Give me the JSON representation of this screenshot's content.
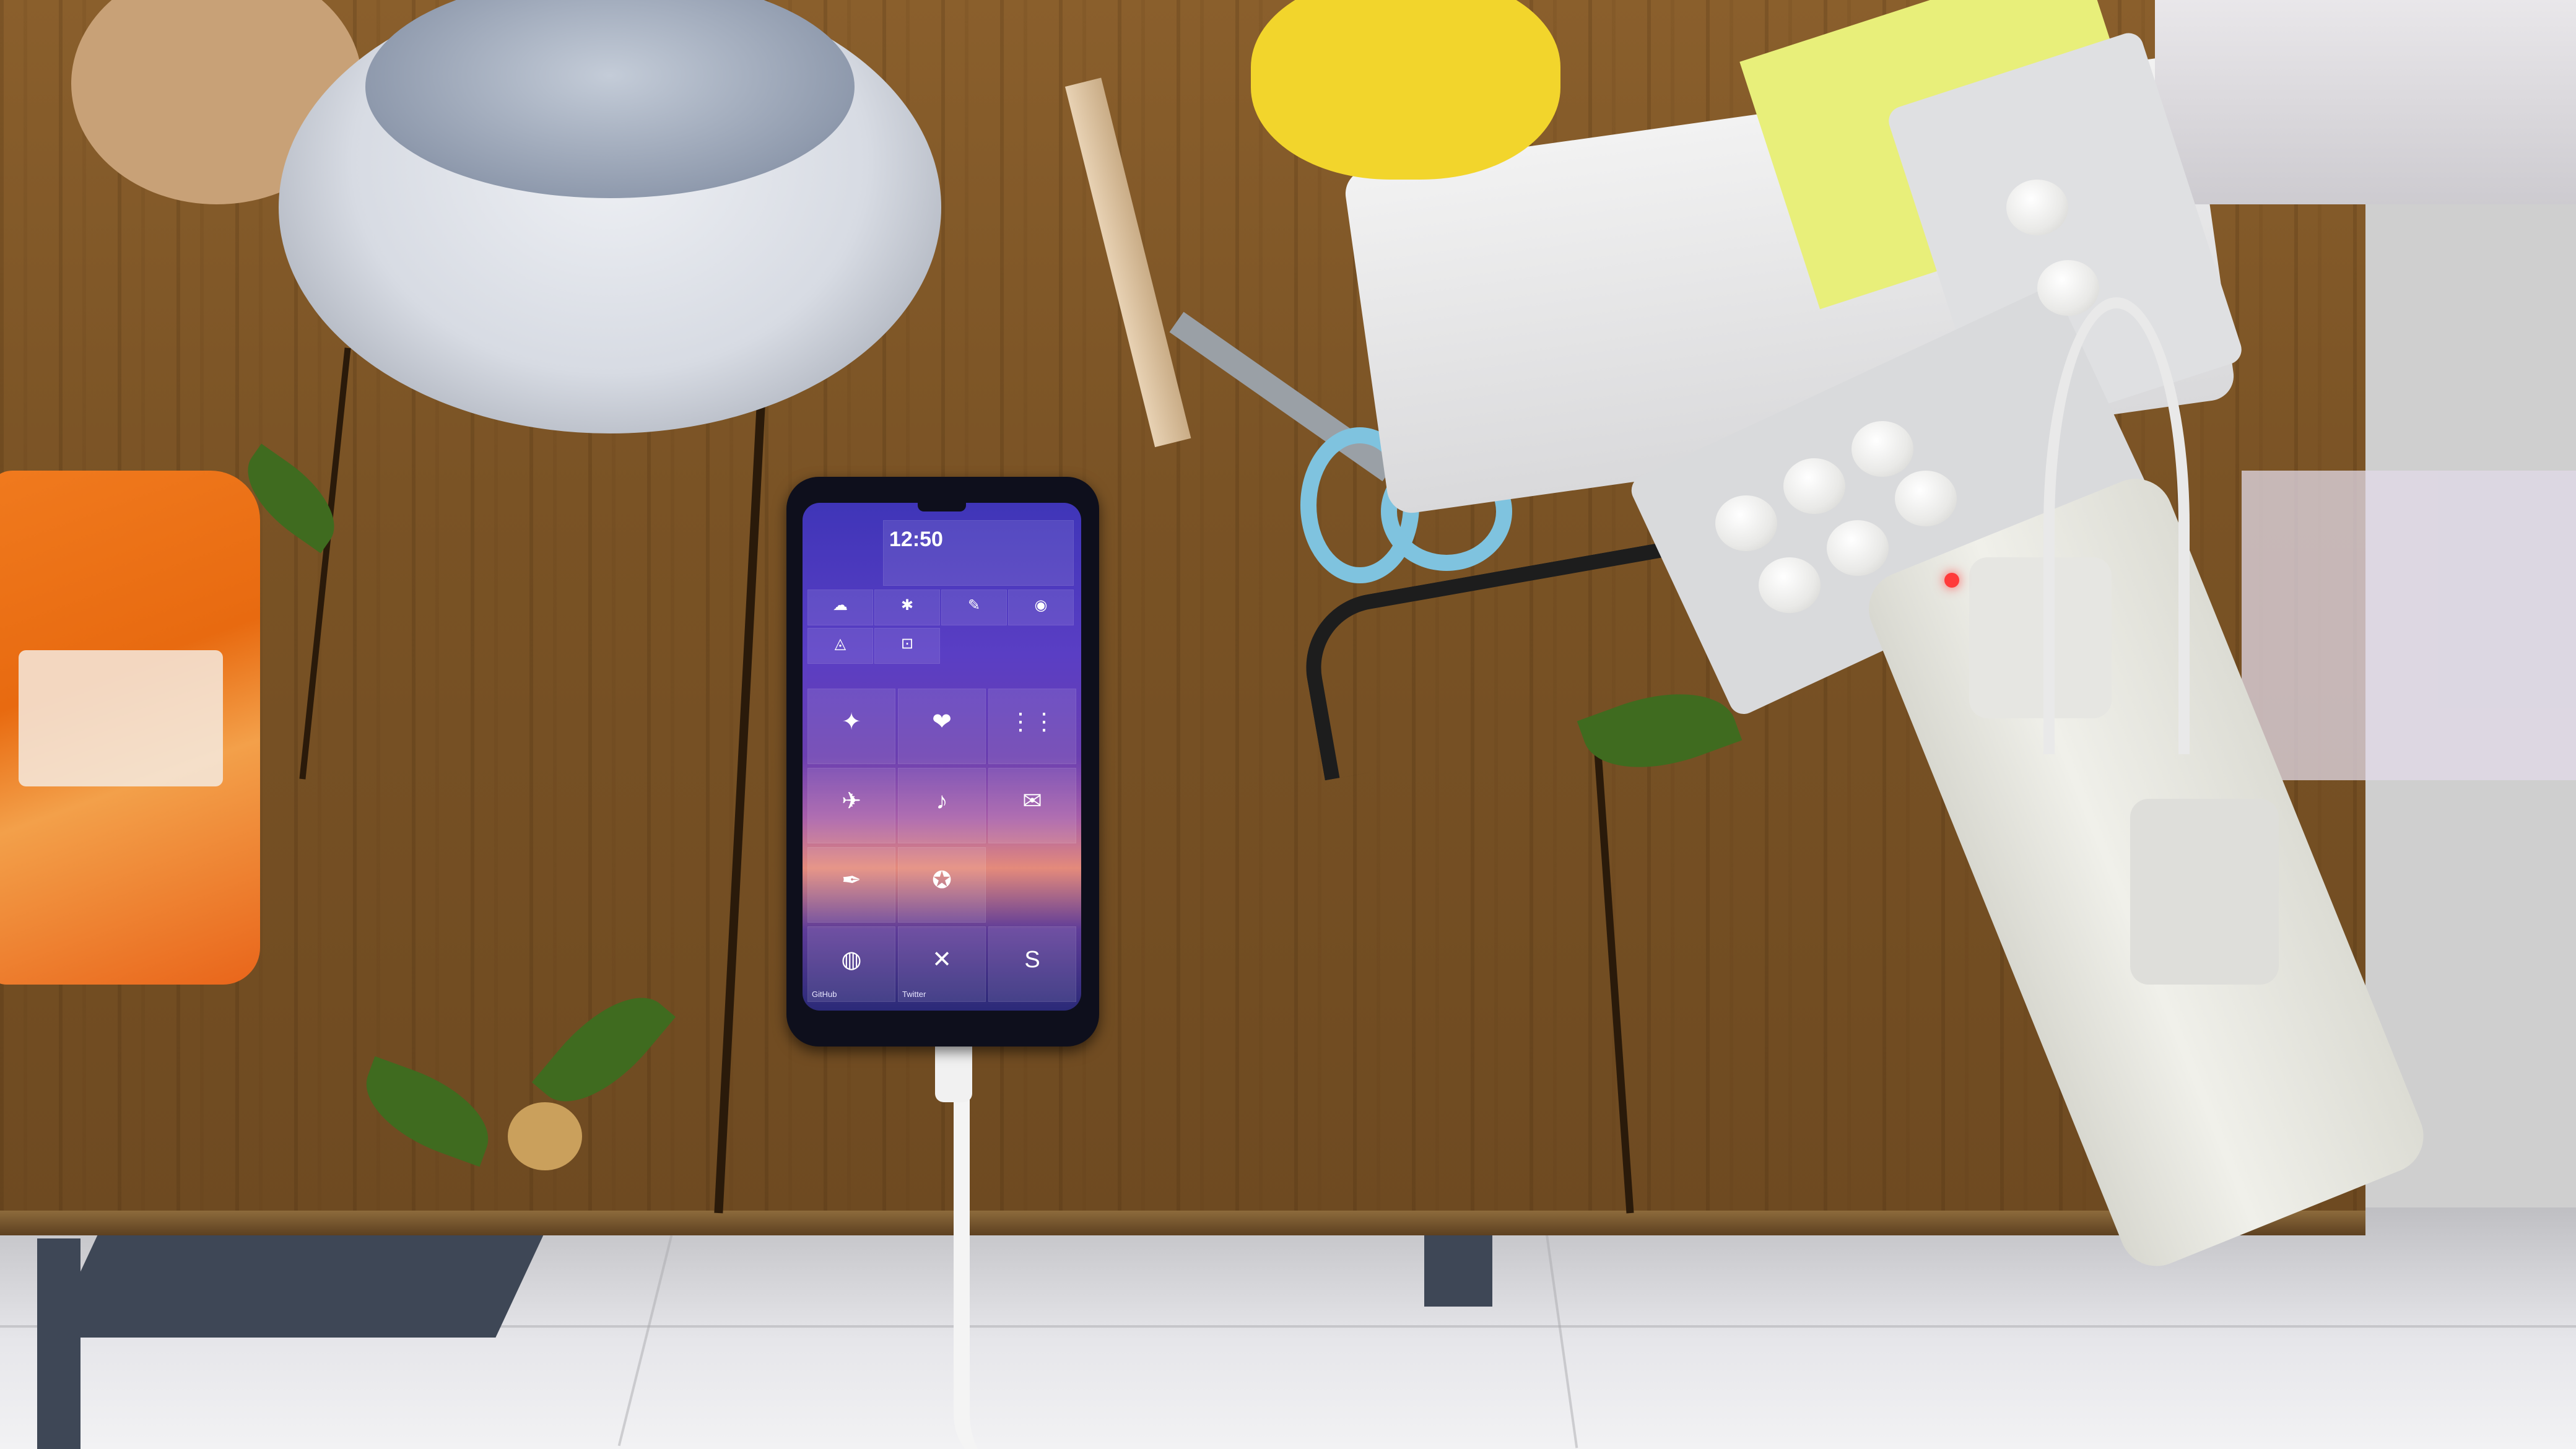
{
  "scene": {
    "setting": "wooden-table-with-household-items",
    "colors": {
      "table_wood": "#7a5325",
      "phone_body": "#0e0f1c",
      "screen_gradient_top": "#3f35b8",
      "screen_gradient_mid": "#e48a7b",
      "snack_bag": "#f07a1e",
      "scissors_handle": "#7fc3df",
      "power_strip": "#f0f0ea",
      "led": "#ff3a3a"
    }
  },
  "phone": {
    "status": "charging",
    "home_screen": {
      "clock": "12:50",
      "date": "",
      "tiles": [
        {
          "name": "tile-weather",
          "icon": "cloud-icon",
          "glyph": "☁",
          "label": ""
        },
        {
          "name": "tile-settings",
          "icon": "settings-icon",
          "glyph": "✱",
          "label": ""
        },
        {
          "name": "tile-edit",
          "icon": "pencil-icon",
          "glyph": "✎",
          "label": ""
        },
        {
          "name": "tile-camera",
          "icon": "camera-icon",
          "glyph": "◉",
          "label": ""
        },
        {
          "name": "tile-notify",
          "icon": "bell-icon",
          "glyph": "◬",
          "label": ""
        },
        {
          "name": "tile-lock",
          "icon": "lock-icon",
          "glyph": "⊡",
          "label": ""
        },
        {
          "name": "tile-apps",
          "icon": "puzzle-icon",
          "glyph": "✦",
          "label": ""
        },
        {
          "name": "tile-photos",
          "icon": "heart-icon",
          "glyph": "❤",
          "label": ""
        },
        {
          "name": "tile-grid",
          "icon": "grid-icon",
          "glyph": "⋮⋮",
          "label": ""
        },
        {
          "name": "tile-send",
          "icon": "send-icon",
          "glyph": "✈",
          "label": ""
        },
        {
          "name": "tile-music",
          "icon": "music-icon",
          "glyph": "♪",
          "label": ""
        },
        {
          "name": "tile-chat",
          "icon": "chat-icon",
          "glyph": "✉",
          "label": ""
        },
        {
          "name": "tile-pen",
          "icon": "pen-icon",
          "glyph": "✒",
          "label": ""
        },
        {
          "name": "tile-compass",
          "icon": "compass-icon",
          "glyph": "✪",
          "label": ""
        },
        {
          "name": "tile-github",
          "icon": "github-icon",
          "glyph": "◍",
          "label": "GitHub"
        },
        {
          "name": "tile-twitter",
          "icon": "twitter-icon",
          "glyph": "✕",
          "label": "Twitter"
        },
        {
          "name": "tile-sale",
          "icon": "sale-icon",
          "glyph": "S",
          "label": ""
        }
      ]
    }
  }
}
